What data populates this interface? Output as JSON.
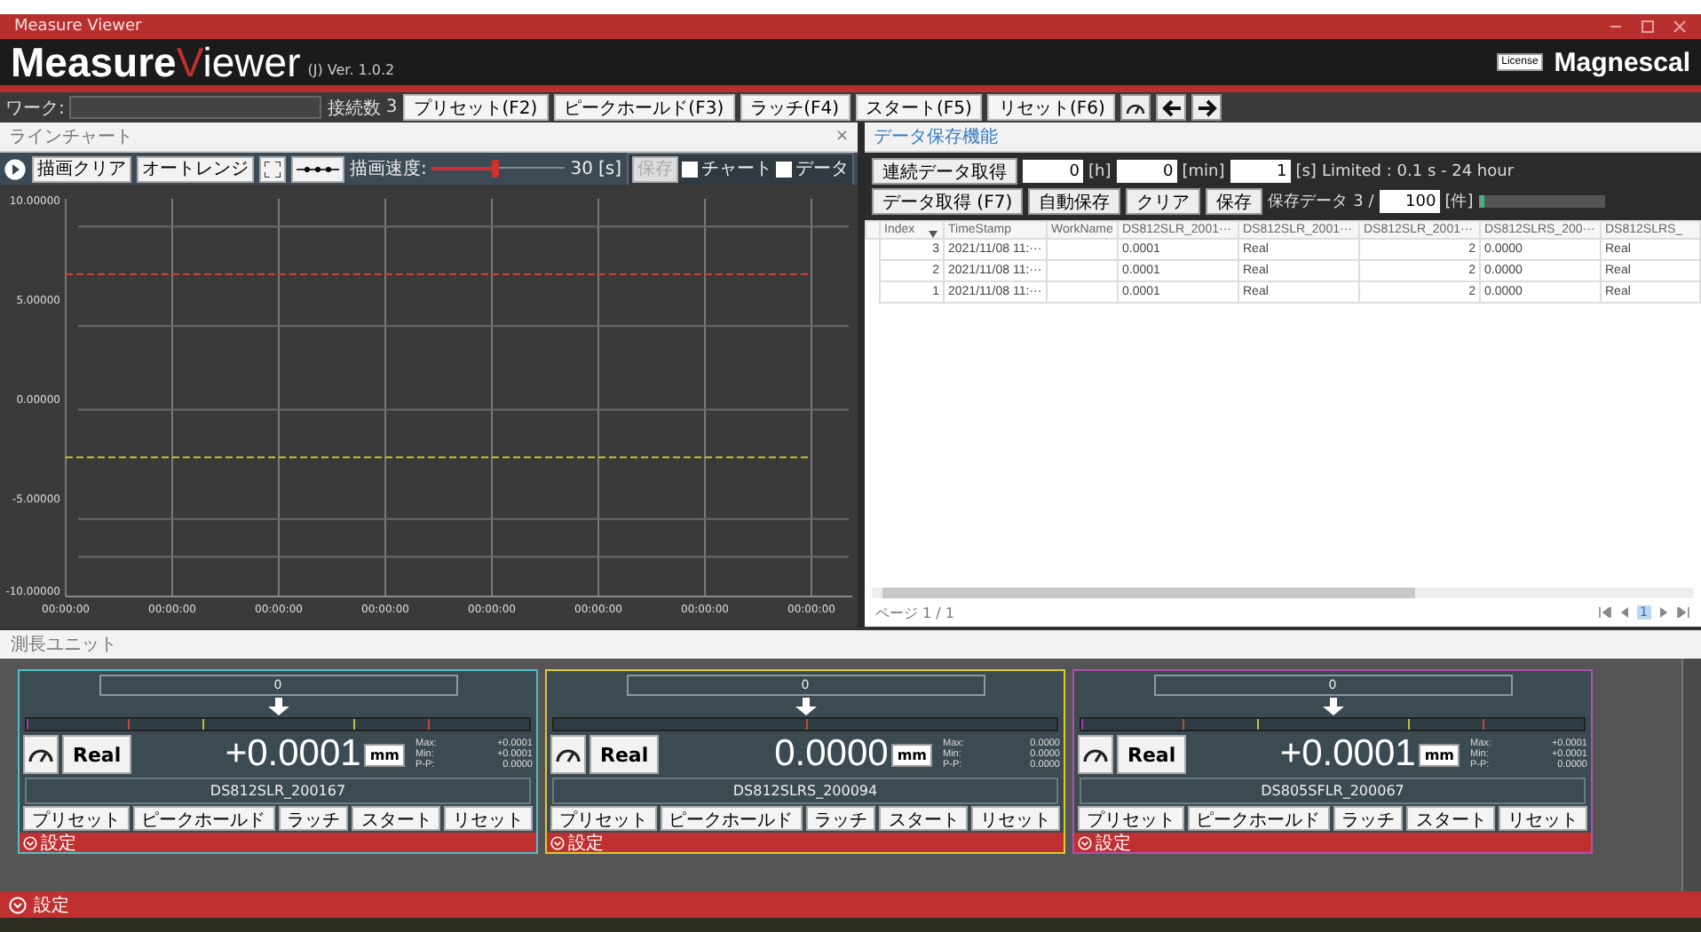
{
  "window": {
    "title": "Measure Viewer"
  },
  "app_header": {
    "logo": [
      "Measure",
      "V",
      "iewer"
    ],
    "edition": "(J) Ver. 1.0.2",
    "license_button": "License",
    "brand": "Magnescal"
  },
  "toolbar": {
    "work_label": "ワーク:",
    "connections_label": "接続数",
    "connections": "3",
    "buttons": [
      "プリセット(F2)",
      "ピークホールド(F3)",
      "ラッチ(F4)",
      "スタート(F5)",
      "リセット(F6)"
    ]
  },
  "chart_panel": {
    "title": "ラインチャート",
    "close": "×",
    "buttons": [
      "描画クリア",
      "オートレンジ"
    ],
    "speed_label": "描画速度:",
    "speed_slider": {
      "level": 0.48
    },
    "speed_value": "30",
    "speed_unit": "[s]",
    "save_button": {
      "label": "保存",
      "disabled": true
    },
    "checks": [
      {
        "label": "チャート",
        "checked": false
      },
      {
        "label": "データ",
        "checked": false
      }
    ],
    "chart_data": {
      "type": "line",
      "categories": [
        "00:00:00",
        "00:00:00",
        "00:00:00",
        "00:00:00",
        "00:00:00",
        "00:00:00",
        "00:00:00",
        "00:00:00"
      ],
      "ylim": [
        -10,
        10
      ],
      "grid": true,
      "yticks": [
        {
          "value": 10,
          "label": "10.00000"
        },
        {
          "value": 5,
          "label": "5.00000"
        },
        {
          "value": 0,
          "label": "0.00000"
        },
        {
          "value": -5,
          "label": "-5.00000"
        },
        {
          "value": -10,
          "label": "-10.00000"
        }
      ],
      "series": [
        {
          "color": "#d04030",
          "line_style": "dashed",
          "values": [
            6.2,
            6.2,
            6.2,
            6.2,
            6.2,
            6.2,
            6.2,
            6.2
          ]
        },
        {
          "color": "#c8c030",
          "line_style": "dashed",
          "values": [
            -3,
            -3,
            -3,
            -3,
            -3,
            -3,
            -3,
            -3
          ]
        }
      ]
    }
  },
  "data_panel": {
    "title": "データ保存機能",
    "continuous_button": "連続データ取得",
    "durations": [
      {
        "value": "0",
        "unit": "[h]"
      },
      {
        "value": "0",
        "unit": "[min]"
      },
      {
        "value": "1",
        "unit": "[s]"
      }
    ],
    "limit_note": "Limited : 0.1 s - 24 hour",
    "actions": [
      "データ取得 (F7)",
      "自動保存",
      "クリア",
      "保存"
    ],
    "saved_label": "保存データ",
    "saved_count": "3 /",
    "capacity": "100",
    "capacity_unit": "[件]",
    "capacity_progress": {
      "level": 0.03
    },
    "table": {
      "columns": [
        "Index",
        "TimeStamp",
        "WorkName",
        "DS812SLR_2001···",
        "DS812SLR_2001···",
        "DS812SLR_2001···",
        "DS812SLRS_200···",
        "DS812SLRS_"
      ],
      "rows": [
        [
          "3",
          "2021/11/08 11:···",
          "",
          "0.0001",
          "Real",
          "2",
          "0.0000",
          "Real"
        ],
        [
          "2",
          "2021/11/08 11:···",
          "",
          "0.0001",
          "Real",
          "2",
          "0.0000",
          "Real"
        ],
        [
          "1",
          "2021/11/08 11:···",
          "",
          "0.0001",
          "Real",
          "2",
          "0.0000",
          "Real"
        ]
      ]
    },
    "page": "ページ 1 / 1",
    "current_page": "1"
  },
  "units_panel": {
    "title": "測長ユニット",
    "units": [
      {
        "color": "#4fc0c8",
        "setpoint": "0",
        "limits_shown": true,
        "mode": "Real",
        "value": "+0.0001",
        "unit": "mm",
        "stats": [
          {
            "label": "Max:",
            "value": "+0.0001"
          },
          {
            "label": "Min:",
            "value": "+0.0001"
          },
          {
            "label": "P-P:",
            "value": "0.0000"
          }
        ],
        "name": "DS812SLR_200167",
        "buttons": [
          "プリセット",
          "ピークホールド",
          "ラッチ",
          "スタート",
          "リセット"
        ],
        "settings": "設定"
      },
      {
        "color": "#d8cc30",
        "setpoint": "0",
        "limits_shown": false,
        "mode": "Real",
        "value": "0.0000",
        "unit": "mm",
        "stats": [
          {
            "label": "Max:",
            "value": "0.0000"
          },
          {
            "label": "Min:",
            "value": "0.0000"
          },
          {
            "label": "P-P:",
            "value": "0.0000"
          }
        ],
        "name": "DS812SLRS_200094",
        "buttons": [
          "プリセット",
          "ピークホールド",
          "ラッチ",
          "スタート",
          "リセット"
        ],
        "settings": "設定"
      },
      {
        "color": "#b050b0",
        "setpoint": "0",
        "limits_shown": true,
        "mode": "Real",
        "value": "+0.0001",
        "unit": "mm",
        "stats": [
          {
            "label": "Max:",
            "value": "+0.0001"
          },
          {
            "label": "Min:",
            "value": "+0.0001"
          },
          {
            "label": "P-P:",
            "value": "0.0000"
          }
        ],
        "name": "DS805SFLR_200067",
        "buttons": [
          "プリセット",
          "ピークホールド",
          "ラッチ",
          "スタート",
          "リセット"
        ],
        "settings": "設定"
      }
    ]
  },
  "footer": {
    "settings": "設定"
  }
}
